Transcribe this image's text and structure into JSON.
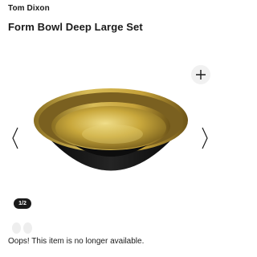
{
  "product": {
    "brand": "Tom Dixon",
    "title": "Form Bowl Deep Large Set"
  },
  "gallery": {
    "counter": "1/2",
    "add_icon": "plus-icon",
    "prev_icon": "chevron-left-icon",
    "next_icon": "chevron-right-icon"
  },
  "variant_swatches": 2,
  "availability": {
    "message": "Oops! This item is no longer available."
  },
  "colors": {
    "text": "#1a1a1a",
    "bowl_exterior": "#141414",
    "bowl_interior_gold": "#c9a83c",
    "button_bg": "#f1f1f1"
  }
}
